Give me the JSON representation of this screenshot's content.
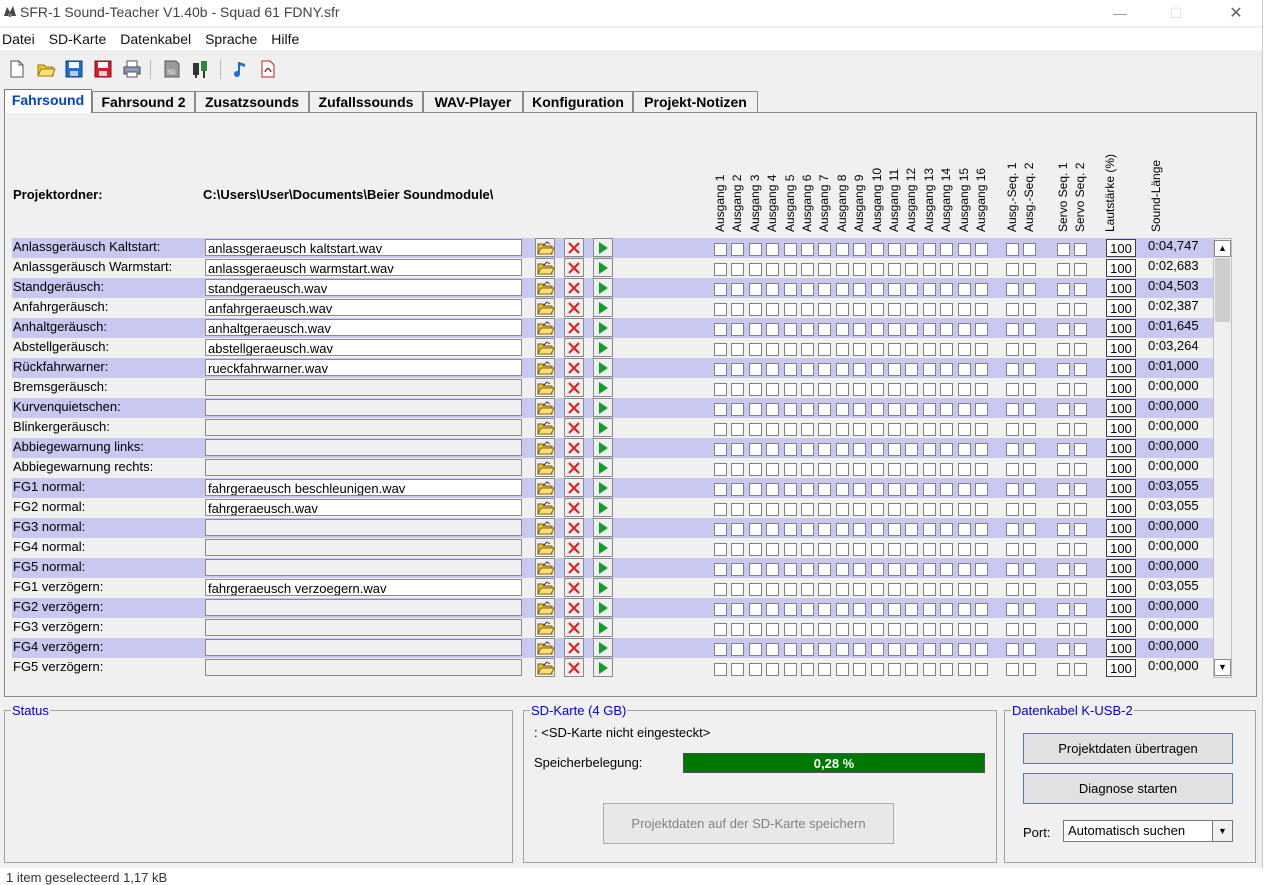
{
  "window": {
    "title": "SFR-1 Sound-Teacher V1.40b - Squad 61 FDNY.sfr",
    "minimize": "—",
    "maximize": "☐",
    "close": "✕"
  },
  "menu": [
    "Datei",
    "SD-Karte",
    "Datenkabel",
    "Sprache",
    "Hilfe"
  ],
  "toolbar": [
    "new-icon",
    "open-icon",
    "save-icon",
    "save-as-icon",
    "print-icon",
    "sd-card-icon",
    "usb-cable-icon",
    "music-note-icon",
    "pdf-icon"
  ],
  "tabs": [
    "Fahrsound",
    "Fahrsound 2",
    "Zusatzsounds",
    "Zufallssounds",
    "WAV-Player",
    "Konfiguration",
    "Projekt-Notizen"
  ],
  "project": {
    "label": "Projektordner:",
    "path": "C:\\Users\\User\\Documents\\Beier Soundmodule\\"
  },
  "columns": {
    "ausgang": [
      "Ausgang 1",
      "Ausgang 2",
      "Ausgang 3",
      "Ausgang 4",
      "Ausgang 5",
      "Ausgang 6",
      "Ausgang 7",
      "Ausgang 8",
      "Ausgang 9",
      "Ausgang 10",
      "Ausgang 11",
      "Ausgang 12",
      "Ausgang 13",
      "Ausgang 14",
      "Ausgang 15",
      "Ausgang 16"
    ],
    "seq": [
      "Ausg.-Seq. 1",
      "Ausg.-Seq. 2"
    ],
    "servo": [
      "Servo Seq. 1",
      "Servo Seq. 2"
    ],
    "volume": "Lautstärke (%)",
    "length": "Sound-Länge"
  },
  "rows": [
    {
      "label": "Anlassgeräusch Kaltstart:",
      "file": "anlassgeraeusch kaltstart.wav",
      "volume": "100",
      "length": "0:04,747"
    },
    {
      "label": "Anlassgeräusch Warmstart:",
      "file": "anlassgeraeusch warmstart.wav",
      "volume": "100",
      "length": "0:02,683"
    },
    {
      "label": "Standgeräusch:",
      "file": "standgeraeusch.wav",
      "volume": "100",
      "length": "0:04,503"
    },
    {
      "label": "Anfahrgeräusch:",
      "file": "anfahrgeraeusch.wav",
      "volume": "100",
      "length": "0:02,387"
    },
    {
      "label": "Anhaltgeräusch:",
      "file": "anhaltgeraeusch.wav",
      "volume": "100",
      "length": "0:01,645"
    },
    {
      "label": "Abstellgeräusch:",
      "file": "abstellgeraeusch.wav",
      "volume": "100",
      "length": "0:03,264"
    },
    {
      "label": "Rückfahrwarner:",
      "file": "rueckfahrwarner.wav",
      "volume": "100",
      "length": "0:01,000"
    },
    {
      "label": "Bremsgeräusch:",
      "file": "",
      "volume": "100",
      "length": "0:00,000"
    },
    {
      "label": "Kurvenquietschen:",
      "file": "",
      "volume": "100",
      "length": "0:00,000"
    },
    {
      "label": "Blinkergeräusch:",
      "file": "",
      "volume": "100",
      "length": "0:00,000"
    },
    {
      "label": "Abbiegewarnung links:",
      "file": "",
      "volume": "100",
      "length": "0:00,000"
    },
    {
      "label": "Abbiegewarnung rechts:",
      "file": "",
      "volume": "100",
      "length": "0:00,000"
    },
    {
      "label": "FG1 normal:",
      "file": "fahrgeraeusch beschleunigen.wav",
      "volume": "100",
      "length": "0:03,055"
    },
    {
      "label": "FG2 normal:",
      "file": "fahrgeraeusch.wav",
      "volume": "100",
      "length": "0:03,055"
    },
    {
      "label": "FG3 normal:",
      "file": "",
      "volume": "100",
      "length": "0:00,000"
    },
    {
      "label": "FG4 normal:",
      "file": "",
      "volume": "100",
      "length": "0:00,000"
    },
    {
      "label": "FG5 normal:",
      "file": "",
      "volume": "100",
      "length": "0:00,000"
    },
    {
      "label": "FG1 verzögern:",
      "file": "fahrgeraeusch verzoegern.wav",
      "volume": "100",
      "length": "0:03,055"
    },
    {
      "label": "FG2 verzögern:",
      "file": "",
      "volume": "100",
      "length": "0:00,000"
    },
    {
      "label": "FG3 verzögern:",
      "file": "",
      "volume": "100",
      "length": "0:00,000"
    },
    {
      "label": "FG4 verzögern:",
      "file": "",
      "volume": "100",
      "length": "0:00,000"
    },
    {
      "label": "FG5 verzögern:",
      "file": "",
      "volume": "100",
      "length": "0:00,000"
    }
  ],
  "status": {
    "legend": "Status"
  },
  "sd": {
    "legend": "SD-Karte (4 GB)",
    "state": ": <SD-Karte nicht eingesteckt>",
    "usage_label": "Speicherbelegung:",
    "usage_percent": "0,28 %",
    "save_button": "Projektdaten auf der SD-Karte speichern"
  },
  "cable": {
    "legend": "Datenkabel K-USB-2",
    "transfer_button": "Projektdaten übertragen",
    "diagnose_button": "Diagnose starten",
    "port_label": "Port:",
    "port_value": "Automatisch suchen"
  },
  "footer": "1 item geselecteerd  1,17 kB",
  "colors": {
    "band": "#c8c8f0",
    "tab_active": "#0044cc",
    "legend": "#0000cc",
    "progress": "#007800"
  }
}
